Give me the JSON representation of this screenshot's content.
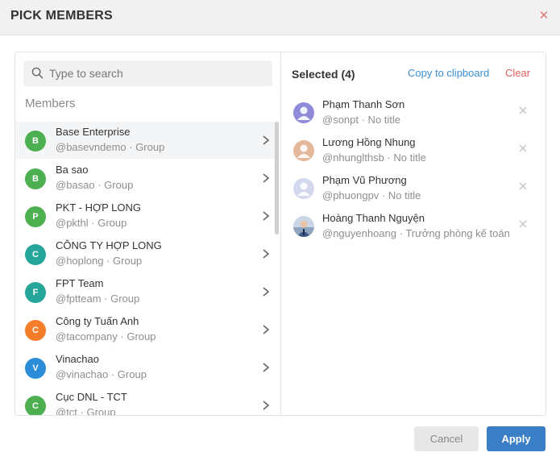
{
  "dialog": {
    "title": "PICK MEMBERS",
    "close_icon": "close-icon",
    "accent_color": "#3a7fc6",
    "close_color": "#e07b7b"
  },
  "search": {
    "placeholder": "Type to search",
    "value": "",
    "icon": "search-icon"
  },
  "members": {
    "label": "Members",
    "items": [
      {
        "initial": "B",
        "name": "Base Enterprise",
        "handle": "@basevndemo · Group",
        "color": "#4caf50"
      },
      {
        "initial": "B",
        "name": "Ba sao",
        "handle": "@basao · Group",
        "color": "#4caf50"
      },
      {
        "initial": "P",
        "name": "PKT - HỢP LONG",
        "handle": "@pkthl · Group",
        "color": "#4caf50"
      },
      {
        "initial": "C",
        "name": "CÔNG TY HỢP LONG",
        "handle": "@hoplong · Group",
        "color": "#26a69a"
      },
      {
        "initial": "F",
        "name": "FPT Team",
        "handle": "@fptteam · Group",
        "color": "#26a69a"
      },
      {
        "initial": "C",
        "name": "Công ty Tuấn Anh",
        "handle": "@tacompany · Group",
        "color": "#f57c28"
      },
      {
        "initial": "V",
        "name": "Vinachao",
        "handle": "@vinachao · Group",
        "color": "#2b8cd8"
      },
      {
        "initial": "C",
        "name": "Cục DNL - TCT",
        "handle": "@tct · Group",
        "color": "#4caf50"
      }
    ]
  },
  "selected": {
    "title": "Selected (4)",
    "copy_label": "Copy to clipboard",
    "clear_label": "Clear",
    "items": [
      {
        "name": "Phạm Thanh Sơn",
        "handle": "@sonpt · No title",
        "avatar": "default-avatar-icon",
        "avatar_color": "#8f8bd9"
      },
      {
        "name": "Lương Hồng Nhung",
        "handle": "@nhunglthsb · No title",
        "avatar": "default-avatar-icon",
        "avatar_color": "#e4b89a"
      },
      {
        "name": "Phạm Vũ Phương",
        "handle": "@phuongpv · No title",
        "avatar": "default-avatar-icon",
        "avatar_color": "#d4d8ef"
      },
      {
        "name": "Hoàng Thanh Nguyện",
        "handle": "@nguyenhoang · Trưởng phòng kế toán",
        "avatar": "photo-avatar",
        "avatar_color": "#3d5a8a"
      }
    ]
  },
  "buttons": {
    "cancel_label": "Cancel",
    "apply_label": "Apply"
  }
}
